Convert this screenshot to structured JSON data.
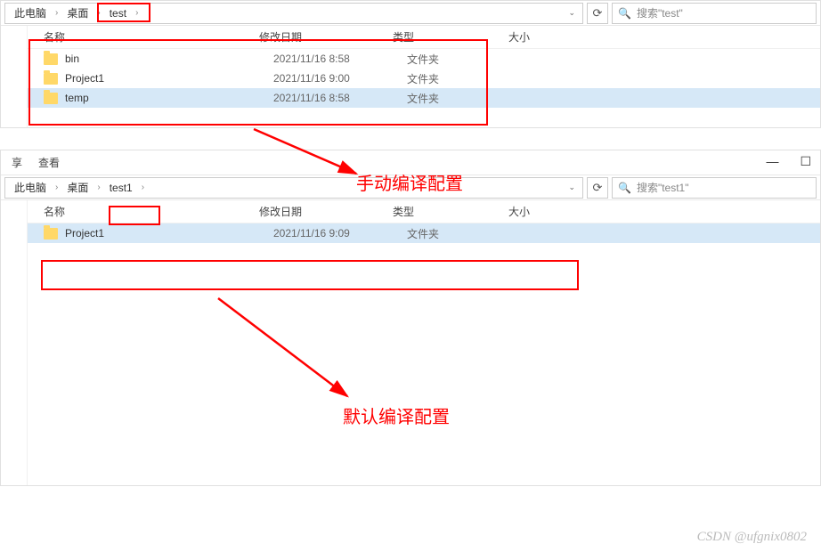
{
  "window1": {
    "breadcrumb": [
      "此电脑",
      "桌面",
      "test"
    ],
    "search_placeholder": "搜索\"test\"",
    "headers": {
      "name": "名称",
      "date": "修改日期",
      "type": "类型",
      "size": "大小"
    },
    "rows": [
      {
        "name": "bin",
        "date": "2021/11/16 8:58",
        "type": "文件夹",
        "selected": false
      },
      {
        "name": "Project1",
        "date": "2021/11/16 9:00",
        "type": "文件夹",
        "selected": false
      },
      {
        "name": "temp",
        "date": "2021/11/16 8:58",
        "type": "文件夹",
        "selected": true
      }
    ]
  },
  "window2": {
    "tabs": [
      "享",
      "查看"
    ],
    "breadcrumb": [
      "此电脑",
      "桌面",
      "test1"
    ],
    "search_placeholder": "搜索\"test1\"",
    "headers": {
      "name": "名称",
      "date": "修改日期",
      "type": "类型",
      "size": "大小"
    },
    "rows": [
      {
        "name": "Project1",
        "date": "2021/11/16 9:09",
        "type": "文件夹",
        "selected": true
      }
    ]
  },
  "annotations": {
    "manual": "手动编译配置",
    "default": "默认编译配置"
  },
  "watermark": "CSDN @ufgnix0802",
  "window_controls": {
    "min": "—",
    "max": "☐"
  }
}
